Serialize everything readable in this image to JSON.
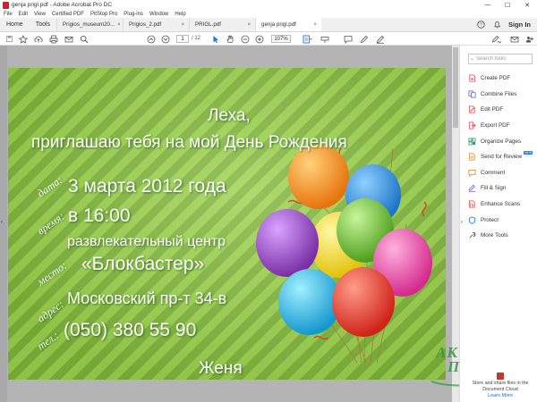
{
  "window": {
    "title": "genja prigl.pdf - Adobe Acrobat Pro DC",
    "controls": [
      "—",
      "☐",
      "✕"
    ]
  },
  "menu": [
    "File",
    "Edit",
    "View",
    "Certified PDF",
    "PitStop Pro",
    "Plug-ins",
    "Window",
    "Help"
  ],
  "tabs": {
    "home": "Home",
    "tools": "Tools",
    "docs": [
      "Prigios_museum20...",
      "Prigios_2.pdf",
      "PRIGL.pdf",
      "genja prigl.pdf"
    ],
    "close": "×",
    "sign_in": "Sign In"
  },
  "toolbar": {
    "page_current": "1",
    "page_total": "/ 12",
    "zoom": "107%"
  },
  "left_panel": {
    "toggle": "‹"
  },
  "invitation": {
    "line1": "Леха,",
    "line2": "приглашаю тебя на мой День Рождения",
    "labels": {
      "date": "дата:",
      "time": "время:",
      "place": "место:",
      "address": "адрес:",
      "phone": "тел.:"
    },
    "date": "3 марта 2012 года",
    "time": "в 16:00",
    "place1": "развлекательный центр",
    "place2": "«Блокбастер»",
    "address": "Московский пр-т 34-в",
    "phone": "(050) 380 55 90",
    "signature": "Женя"
  },
  "watermark": {
    "line1": "АКТИВ",
    "line2": "ПРИНТ"
  },
  "right_panel": {
    "search_placeholder": "Search tools",
    "collapse": "›",
    "tools": [
      {
        "label": "Create PDF",
        "icon": "create-pdf-icon",
        "color": "#e34850"
      },
      {
        "label": "Combine Files",
        "icon": "combine-files-icon",
        "color": "#7c57d4"
      },
      {
        "label": "Edit PDF",
        "icon": "edit-pdf-icon",
        "color": "#e34850"
      },
      {
        "label": "Export PDF",
        "icon": "export-pdf-icon",
        "color": "#e34850"
      },
      {
        "label": "Organize Pages",
        "icon": "organize-pages-icon",
        "color": "#2d9d78"
      },
      {
        "label": "Send for Review",
        "icon": "send-for-review-icon",
        "color": "#e68619",
        "badge": "NEW"
      },
      {
        "label": "Comment",
        "icon": "comment-icon",
        "color": "#e68619"
      },
      {
        "label": "Fill & Sign",
        "icon": "fill-sign-icon",
        "color": "#7c57d4"
      },
      {
        "label": "Enhance Scans",
        "icon": "enhance-scans-icon",
        "color": "#e34850"
      },
      {
        "label": "Protect",
        "icon": "protect-icon",
        "color": "#1473e6"
      },
      {
        "label": "More Tools",
        "icon": "more-tools-icon",
        "color": "#555555"
      }
    ],
    "promo_text": "Store and share files in the Document Cloud",
    "promo_link": "Learn More"
  }
}
